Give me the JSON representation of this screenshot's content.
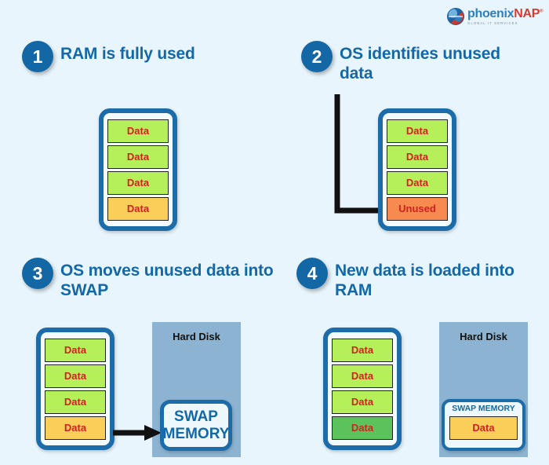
{
  "background_color": "#e8f5fc",
  "accent_color": "#1368a8",
  "logo": {
    "name": "phoenixnap-logo",
    "word_part1": "phoenix",
    "word_part2": "NAP",
    "trademark": "®",
    "tagline": "GLOBAL IT SERVICES",
    "icon": "globe-icon"
  },
  "steps": [
    {
      "number": "1",
      "title": "RAM is fully used",
      "ram": {
        "label": "ram-module",
        "cells": [
          {
            "text": "Data",
            "state": "green"
          },
          {
            "text": "Data",
            "state": "green"
          },
          {
            "text": "Data",
            "state": "green"
          },
          {
            "text": "Data",
            "state": "amber"
          }
        ]
      }
    },
    {
      "number": "2",
      "title": "OS identifies unused data",
      "ram": {
        "label": "ram-module",
        "cells": [
          {
            "text": "Data",
            "state": "green"
          },
          {
            "text": "Data",
            "state": "green"
          },
          {
            "text": "Data",
            "state": "green"
          },
          {
            "text": "Unused",
            "state": "orange"
          }
        ]
      },
      "arrow": "pointer-arrow-to-unused-block"
    },
    {
      "number": "3",
      "title": "OS moves unused data into SWAP",
      "ram": {
        "label": "ram-module",
        "cells": [
          {
            "text": "Data",
            "state": "green"
          },
          {
            "text": "Data",
            "state": "green"
          },
          {
            "text": "Data",
            "state": "green"
          },
          {
            "text": "Data",
            "state": "amber"
          }
        ]
      },
      "disk": {
        "label": "Hard Disk",
        "swap": {
          "line1": "SWAP",
          "line2": "MEMORY"
        }
      },
      "arrow": "transfer-arrow-ram-to-swap"
    },
    {
      "number": "4",
      "title": "New data is loaded into RAM",
      "ram": {
        "label": "ram-module",
        "cells": [
          {
            "text": "Data",
            "state": "green"
          },
          {
            "text": "Data",
            "state": "green"
          },
          {
            "text": "Data",
            "state": "green"
          },
          {
            "text": "Data",
            "state": "green2"
          }
        ]
      },
      "disk": {
        "label": "Hard Disk",
        "swap": {
          "title": "SWAP MEMORY",
          "cell": {
            "text": "Data",
            "state": "amber"
          }
        }
      }
    }
  ],
  "colors": {
    "badge": "#1367a4",
    "ram_border": "#1b6ca8",
    "cell_green": "#b5f05a",
    "cell_green_dark": "#5cc35c",
    "cell_amber": "#f9cf5a",
    "cell_orange": "#f68a4f",
    "cell_text": "#d32020",
    "disk_panel": "#8cb4d2",
    "arrow": "#111111"
  }
}
